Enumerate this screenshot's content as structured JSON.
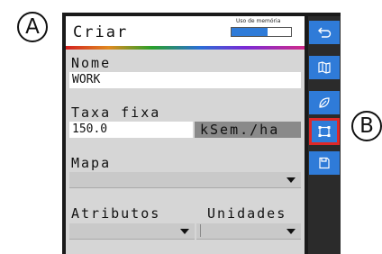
{
  "callouts": {
    "a": "A",
    "b": "B"
  },
  "header": {
    "title": "Criar",
    "memory_label": "Uso de memória",
    "memory_usage": 0.6
  },
  "form": {
    "name_label": "Nome",
    "name_value": "WORK",
    "rate_label": "Taxa fixa",
    "rate_value": "150.0",
    "rate_unit": "kSem./ha",
    "map_label": "Mapa",
    "attributes_label": "Atributos",
    "units_label": "Unidades"
  },
  "sidebar": {
    "buttons": [
      {
        "icon": "back-arrow-icon"
      },
      {
        "icon": "map-icon"
      },
      {
        "icon": "leaf-icon"
      },
      {
        "icon": "boundary-icon",
        "selected": true
      },
      {
        "icon": "save-icon"
      }
    ]
  },
  "colors": {
    "accent": "#2f7bd8",
    "highlight": "#e02828",
    "panel": "#d6d6d6",
    "unit_box": "#8a8a8a"
  }
}
